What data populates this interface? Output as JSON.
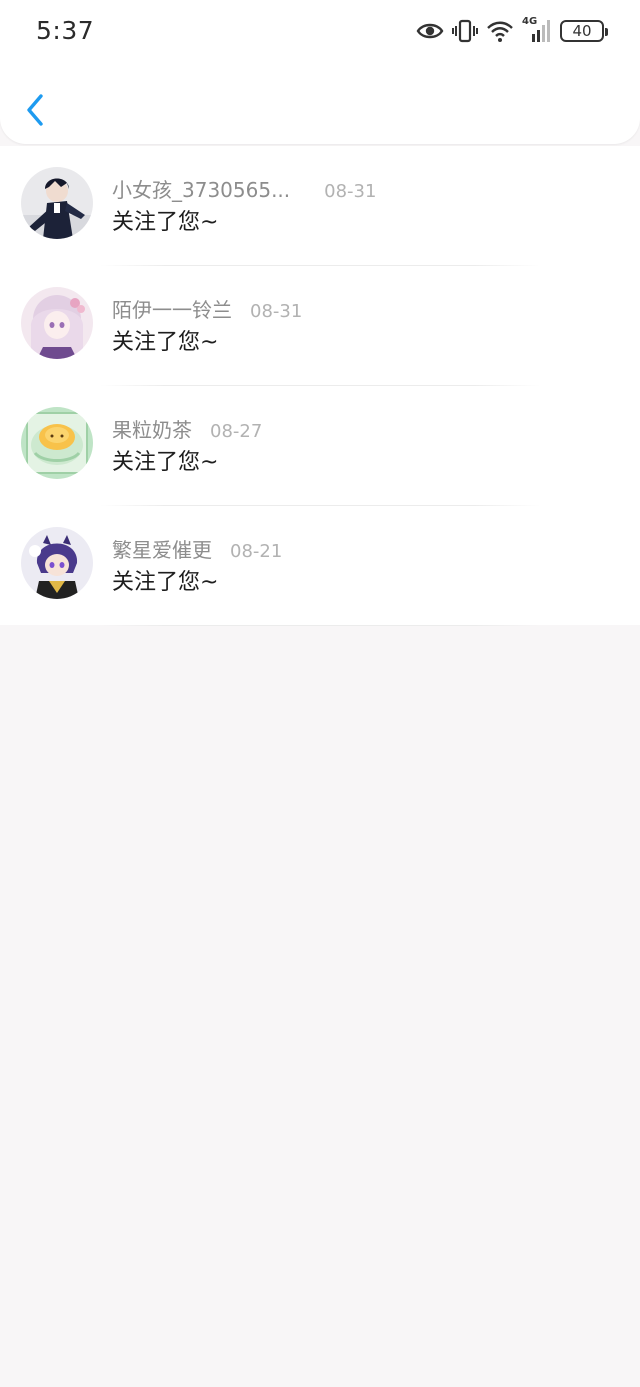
{
  "status_bar": {
    "time": "5:37",
    "network_label": "4G",
    "battery": "40"
  },
  "nav": {
    "back_icon": "chevron-left-icon",
    "accent_color": "#1e9bf0"
  },
  "notifications": [
    {
      "username": "小女孩_3730565...",
      "date": "08-31",
      "message": "关注了您~",
      "avatar_icon": "avatar-dark-suit"
    },
    {
      "username": "陌伊一一铃兰",
      "date": "08-31",
      "message": "关注了您~",
      "avatar_icon": "avatar-lilac-hair"
    },
    {
      "username": "果粒奶茶",
      "date": "08-27",
      "message": "关注了您~",
      "avatar_icon": "avatar-egg-tart"
    },
    {
      "username": "繁星爱催更",
      "date": "08-21",
      "message": "关注了您~",
      "avatar_icon": "avatar-purple-hair"
    }
  ]
}
